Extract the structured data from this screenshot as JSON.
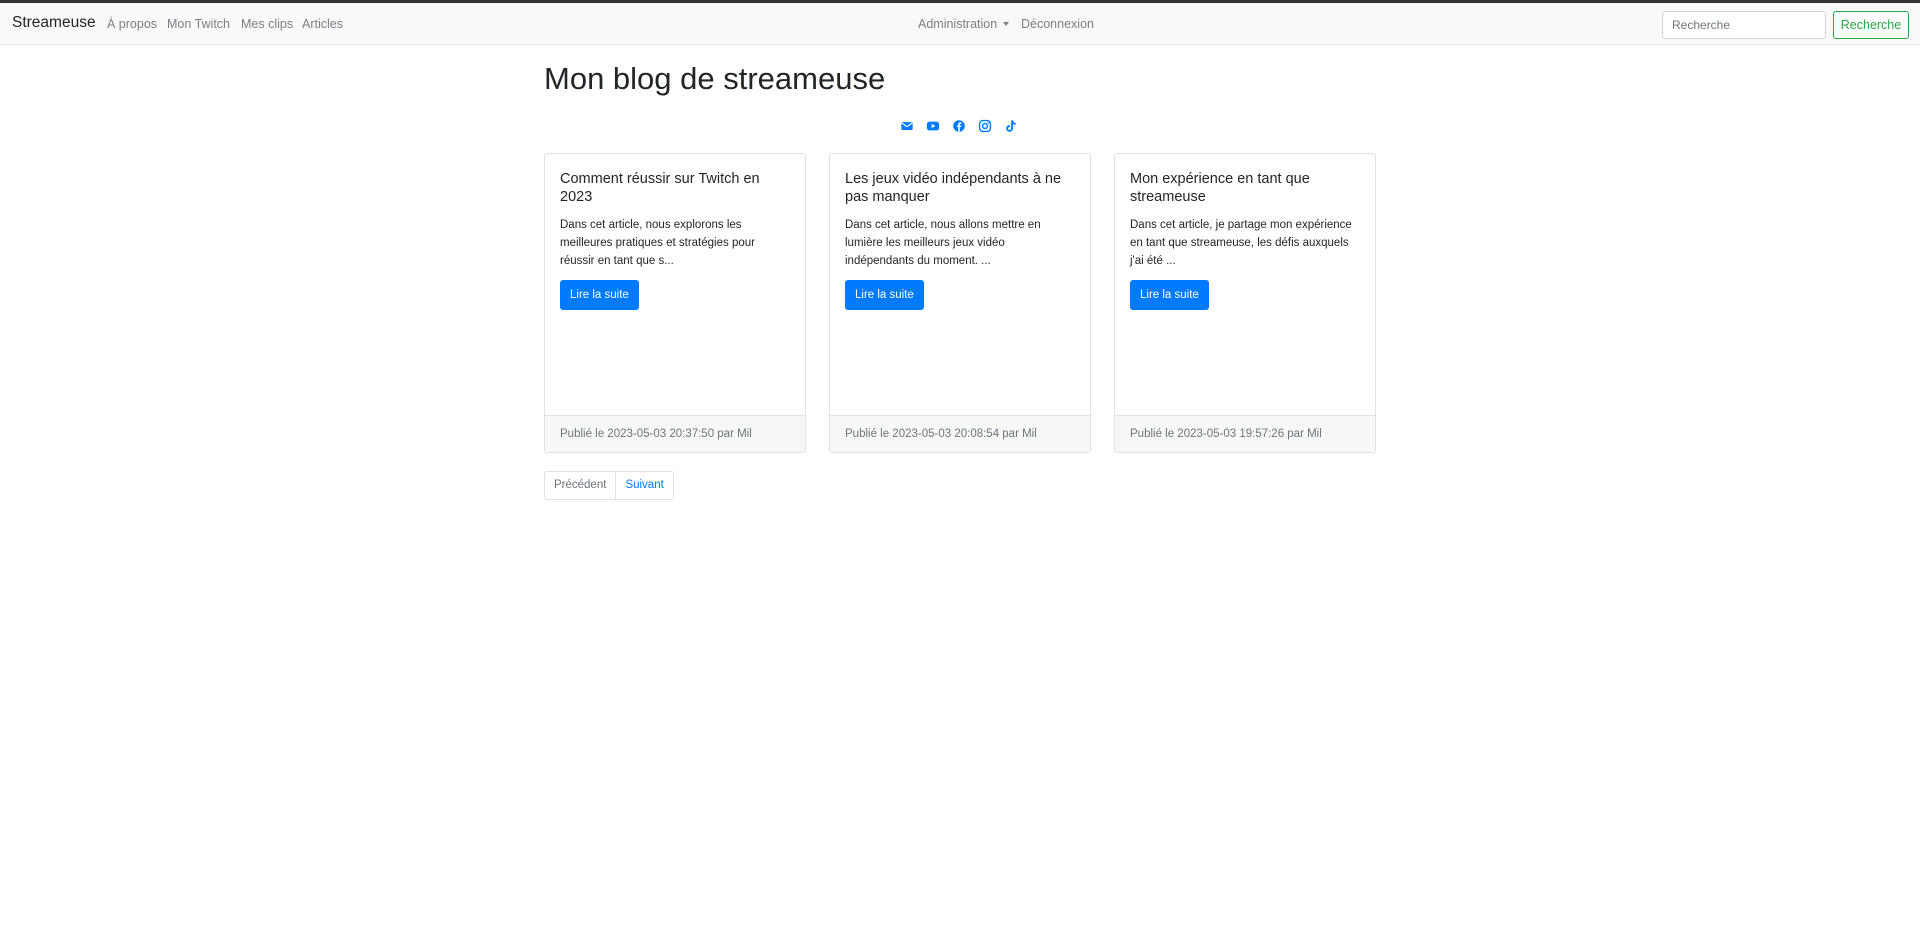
{
  "navbar": {
    "brand": "Streameuse",
    "links": [
      {
        "label": "À propos"
      },
      {
        "label": "Mon Twitch"
      },
      {
        "label": "Mes clips"
      },
      {
        "label": "Articles"
      }
    ],
    "admin_label": "Administration",
    "logout_label": "Déconnexion",
    "search_placeholder": "Recherche",
    "search_button": "Recherche"
  },
  "page": {
    "title": "Mon blog de streameuse"
  },
  "social_icons": [
    "mail-icon",
    "youtube-icon",
    "facebook-icon",
    "instagram-icon",
    "tiktok-icon"
  ],
  "articles": [
    {
      "title": "Comment réussir sur Twitch en 2023",
      "excerpt": "Dans cet article, nous explorons les meilleures pratiques et stratégies pour réussir en tant que s...",
      "button": "Lire la suite",
      "footer": "Publié le 2023-05-03 20:37:50 par Mil"
    },
    {
      "title": "Les jeux vidéo indépendants à ne pas manquer",
      "excerpt": "Dans cet article, nous allons mettre en lumière les meilleurs jeux vidéo indépendants du moment. ...",
      "button": "Lire la suite",
      "footer": "Publié le 2023-05-03 20:08:54 par Mil"
    },
    {
      "title": "Mon expérience en tant que streameuse",
      "excerpt": "Dans cet article, je partage mon expérience en tant que streameuse, les défis auxquels j'ai été ...",
      "button": "Lire la suite",
      "footer": "Publié le 2023-05-03 19:57:26 par Mil"
    }
  ],
  "pagination": {
    "prev": "Précédent",
    "next": "Suivant"
  },
  "colors": {
    "primary": "#007bff",
    "success": "#28a745",
    "navbar_bg": "#f8f9fa"
  }
}
